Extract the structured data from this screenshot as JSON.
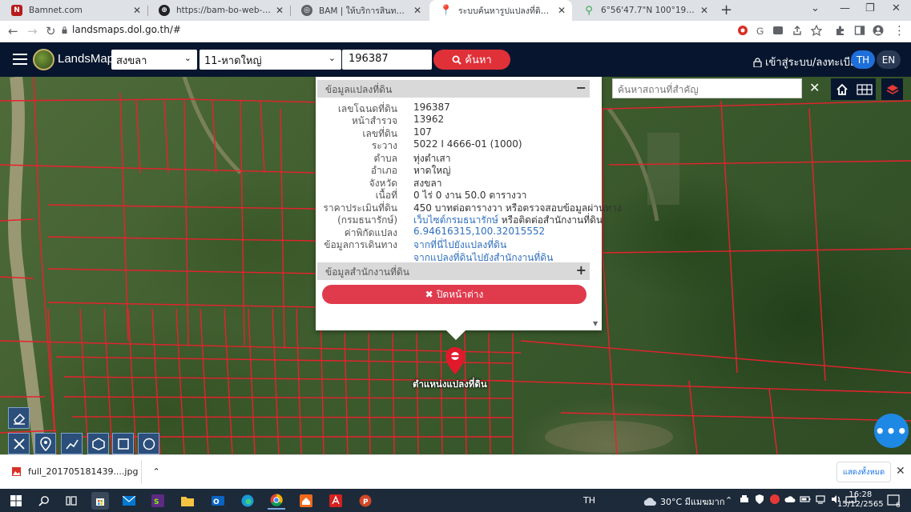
{
  "browser": {
    "tabs": [
      {
        "title": "Bamnet.com",
        "favicon": "bamnet-icon",
        "color": "#b71c1c"
      },
      {
        "title": "https://bam-bo-web-prd.bam.co...",
        "favicon": "globe-icon",
        "color": "#202124"
      },
      {
        "title": "BAM | ให้บริการสินทรัพย์ด้านอสังหาริ...",
        "favicon": "bam-icon",
        "color": "#5f6368"
      },
      {
        "title": "ระบบค้นหารูปแปลงที่ดิน (LandsMaps)",
        "favicon": "map-pin-icon",
        "color": "#e53935"
      },
      {
        "title": "6°56'47.7\"N 100°19'07.7\"E - Goo...",
        "favicon": "google-maps-icon",
        "color": "#34a853"
      }
    ],
    "active_tab": 3,
    "url": "landsmaps.dol.go.th/#"
  },
  "header": {
    "brand": "LandsMaps",
    "province": "สงขลา",
    "district": "11-หาดใหญ่",
    "parcel_number": "196387",
    "search_label": "ค้นหา",
    "login_label": "เข้าสู่ระบบ/ลงทะเบียน",
    "lang_th": "TH",
    "lang_en": "EN",
    "accent": "#e03038"
  },
  "map": {
    "search_placeholder": "ค้นหาสถานที่สำคัญ",
    "marker_label": "ตำแหน่งแปลงที่ดิน"
  },
  "popup": {
    "section1_title": "ข้อมูลแปลงที่ดิน",
    "section1_sign": "−",
    "rows": [
      {
        "key": "เลขโฉนดที่ดิน",
        "value": "196387",
        "link": false
      },
      {
        "key": "หน้าสำรวจ",
        "value": "13962",
        "link": false
      },
      {
        "key": "เลขที่ดิน",
        "value": "107",
        "link": false
      },
      {
        "key": "ระวาง",
        "value": "5022 I 4666-01 (1000)",
        "link": false
      },
      {
        "key": "ตำบล",
        "value": "ทุ่งตำเสา",
        "link": false
      },
      {
        "key": "อำเภอ",
        "value": "หาดใหญ่",
        "link": false
      },
      {
        "key": "จังหวัด",
        "value": "สงขลา",
        "link": false
      },
      {
        "key": "เนื้อที่",
        "value": "0 ไร่ 0 งาน 50.0 ตารางวา",
        "link": false
      },
      {
        "key": "ราคาประเมินที่ดิน",
        "value": "450 บาทต่อตารางวา หรือตรวจสอบข้อมูลผ่านทาง",
        "link": false
      },
      {
        "key": "(กรมธนารักษ์)",
        "value": "",
        "link": false
      },
      {
        "key": "ค่าพิกัดแปลง",
        "value": "6.94616315,100.32015552",
        "link": true
      },
      {
        "key": "ข้อมูลการเดินทาง",
        "value": "จากที่นี่ไปยังแปลงที่ดิน",
        "link": true
      },
      {
        "key": "",
        "value": "จากแปลงที่ดินไปยังสำนักงานที่ดิน",
        "link": true
      }
    ],
    "price_link": "เว็บไซต์กรมธนารักษ์",
    "price_tail": " หรือติดต่อสำนักงานที่ดิน",
    "section2_title": "ข้อมูลสำนักงานที่ดิน",
    "section2_sign": "+",
    "close_label": "ปิดหน้าต่าง"
  },
  "downloads": {
    "filename": "full_201705181439....jpg",
    "show_all": "แสดงทั้งหมด"
  },
  "taskbar": {
    "lang": "TH",
    "weather": "30°C มีแมฆมาก",
    "time": "16:28",
    "date": "15/12/2565",
    "notifications": "6"
  }
}
